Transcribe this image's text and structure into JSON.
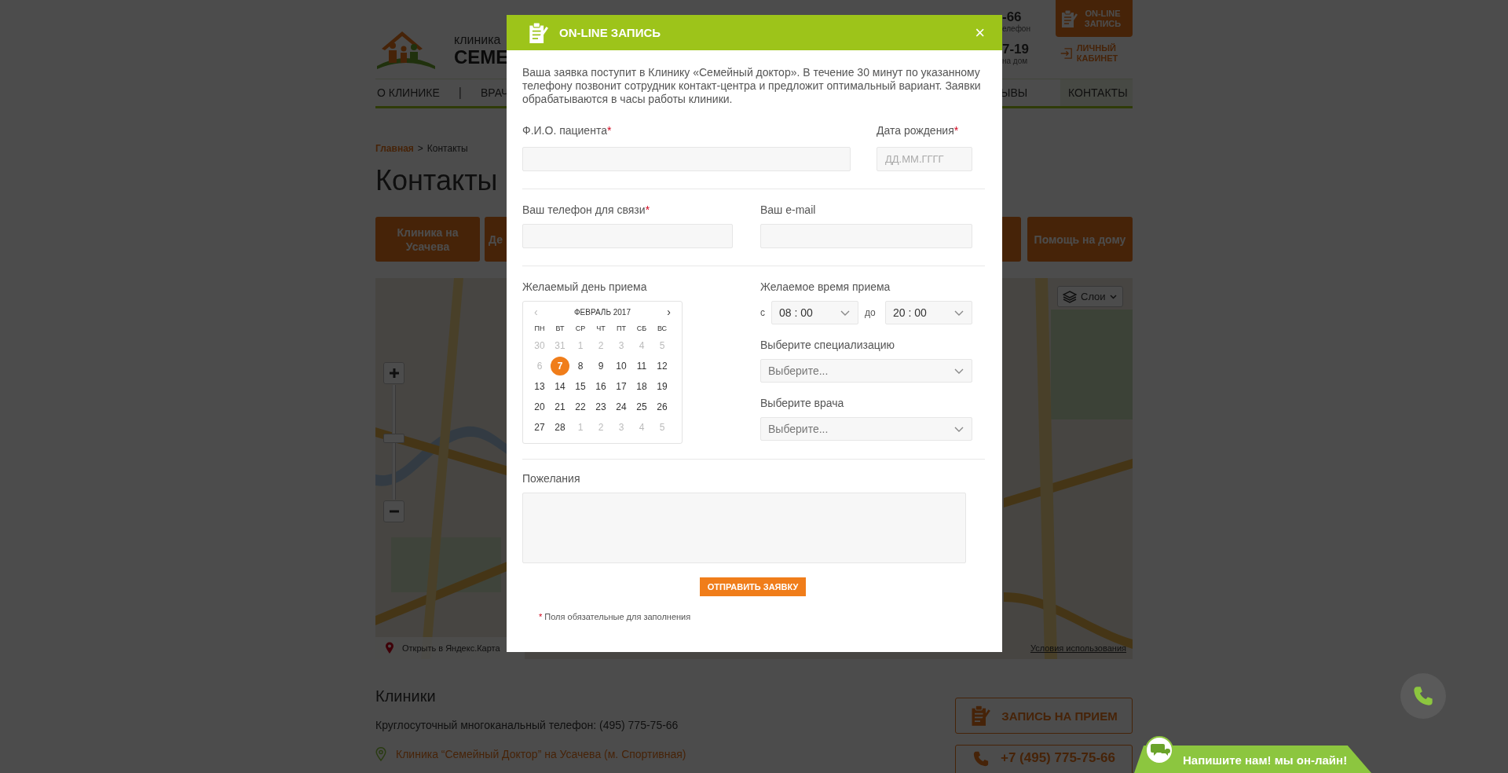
{
  "page": {
    "logo": {
      "line1": "клиника",
      "line2": "СЕМЕ"
    },
    "header_fragments": [
      {
        "value": "-66",
        "caption": "елефон"
      },
      {
        "value": "7-19",
        "caption": "на дом"
      }
    ],
    "header_buttons": {
      "online": "ON-LINE ЗАПИСЬ",
      "cabinet": "ЛИЧНЫЙ КАБИНЕТ"
    },
    "nav_left": [
      {
        "label": "О КЛИНИКЕ",
        "kind": "link"
      },
      {
        "label": "|",
        "kind": "separator"
      },
      {
        "label": "ВРАЧ",
        "kind": "link"
      }
    ],
    "nav_right": [
      {
        "label": "ЫВЫ",
        "selected": false
      },
      {
        "label": "КОНТАКТЫ",
        "selected": true
      }
    ],
    "breadcrumb": {
      "link": "Главная",
      "separator": ">",
      "current": "Контакты"
    },
    "title": "Контакты",
    "clinic_tabs_left": [
      "Клиника на Усачева",
      "Де"
    ],
    "clinic_tabs_right": [
      "Помощь на дому"
    ],
    "map": {
      "zoom": {
        "level": 0.54
      },
      "layers_button": "Слои",
      "open_link": "Открыть в Яндекс.Карта",
      "terms_link": "Условия использования"
    },
    "clinics": {
      "title": "Клиники",
      "phone_line": "Круглосуточный многоканальный телефон: (495) 775-75-66",
      "address_link": "Клиника “Семейный Доктор” на Усачева (м. Спортивная)"
    },
    "side_buttons": {
      "appointment": "ЗАПИСЬ НА ПРИЕМ",
      "phone": "+7 (495) 775-75-66"
    }
  },
  "chat_widget": {
    "label": "Напишите нам! мы он-лайн!"
  },
  "modal": {
    "title": "ON-LINE ЗАПИСЬ",
    "close": "×",
    "intro": "Ваша заявка поступит в Клинику «Семейный доктор». В течение 30 минут по указанному телефону позвонит сотрудник контакт-центра и предложит оптимальный вариант. Заявки обрабатываются в часы работы клиники.",
    "full_name": {
      "label": "Ф.И.О. пациента",
      "required_mark": "*"
    },
    "birth_date": {
      "label": "Дата рождения",
      "required_mark": "*",
      "placeholder": "ДД.ММ.ГГГГ"
    },
    "phone": {
      "label": "Ваш телефон для связи",
      "required_mark": "*"
    },
    "email": {
      "label": "Ваш e-mail"
    },
    "calendar": {
      "label": "Желаемый день приема",
      "prev": "‹",
      "month": "ФЕВРАЛЬ 2017",
      "next": "›",
      "weekdays": [
        "ПН",
        "ВТ",
        "СР",
        "ЧТ",
        "ПТ",
        "СБ",
        "ВС"
      ],
      "weeks": [
        [
          {
            "day": "30",
            "muted": true,
            "selected": false
          },
          {
            "day": "31",
            "muted": true,
            "selected": false
          },
          {
            "day": "1",
            "muted": true,
            "selected": false
          },
          {
            "day": "2",
            "muted": true,
            "selected": false
          },
          {
            "day": "3",
            "muted": true,
            "selected": false
          },
          {
            "day": "4",
            "muted": true,
            "selected": false
          },
          {
            "day": "5",
            "muted": true,
            "selected": false
          }
        ],
        [
          {
            "day": "6",
            "muted": true,
            "selected": false
          },
          {
            "day": "7",
            "muted": false,
            "selected": true
          },
          {
            "day": "8",
            "muted": false,
            "selected": false
          },
          {
            "day": "9",
            "muted": false,
            "selected": false
          },
          {
            "day": "10",
            "muted": false,
            "selected": false
          },
          {
            "day": "11",
            "muted": false,
            "selected": false
          },
          {
            "day": "12",
            "muted": false,
            "selected": false
          }
        ],
        [
          {
            "day": "13",
            "muted": false,
            "selected": false
          },
          {
            "day": "14",
            "muted": false,
            "selected": false
          },
          {
            "day": "15",
            "muted": false,
            "selected": false
          },
          {
            "day": "16",
            "muted": false,
            "selected": false
          },
          {
            "day": "17",
            "muted": false,
            "selected": false
          },
          {
            "day": "18",
            "muted": false,
            "selected": false
          },
          {
            "day": "19",
            "muted": false,
            "selected": false
          }
        ],
        [
          {
            "day": "20",
            "muted": false,
            "selected": false
          },
          {
            "day": "21",
            "muted": false,
            "selected": false
          },
          {
            "day": "22",
            "muted": false,
            "selected": false
          },
          {
            "day": "23",
            "muted": false,
            "selected": false
          },
          {
            "day": "24",
            "muted": false,
            "selected": false
          },
          {
            "day": "25",
            "muted": false,
            "selected": false
          },
          {
            "day": "26",
            "muted": false,
            "selected": false
          }
        ],
        [
          {
            "day": "27",
            "muted": false,
            "selected": false
          },
          {
            "day": "28",
            "muted": false,
            "selected": false
          },
          {
            "day": "1",
            "muted": true,
            "selected": false
          },
          {
            "day": "2",
            "muted": true,
            "selected": false
          },
          {
            "day": "3",
            "muted": true,
            "selected": false
          },
          {
            "day": "4",
            "muted": true,
            "selected": false
          },
          {
            "day": "5",
            "muted": true,
            "selected": false
          }
        ]
      ]
    },
    "time": {
      "label": "Желаемое время приема",
      "from_prefix": "с",
      "from": "08 : 00",
      "to_prefix": "до",
      "to": "20 : 00"
    },
    "specialization": {
      "label": "Выберите специализацию",
      "value": "Выберите..."
    },
    "doctor": {
      "label": "Выберите врача",
      "value": "Выберите..."
    },
    "wishes": {
      "label": "Пожелания"
    },
    "submit": "ОТПРАВИТЬ ЗАЯВКУ",
    "footnote": {
      "mark": "*",
      "text": "Поля обязательные для заполнения"
    }
  }
}
